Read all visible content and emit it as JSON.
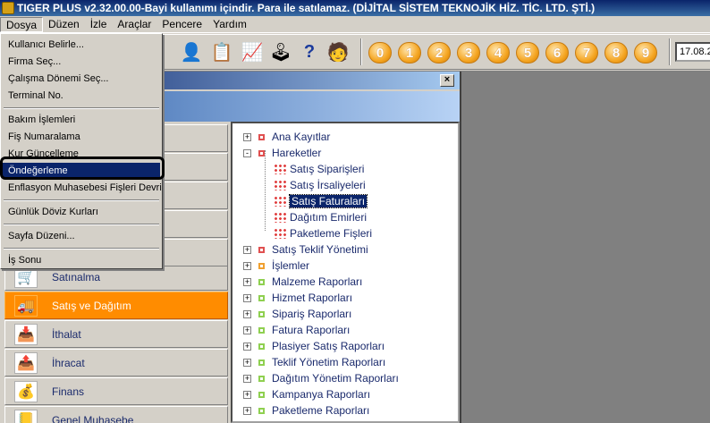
{
  "title": "TIGER PLUS v2.32.00.00-Bayi kullanımı içindir. Para ile satılamaz. (DİJİTAL SİSTEM TEKNOJİK HİZ. TİC. LTD. ŞTİ.)",
  "menubar": [
    "Dosya",
    "Düzen",
    "İzle",
    "Araçlar",
    "Pencere",
    "Yardım"
  ],
  "toolbar": {
    "icons": [
      "user-desk-icon",
      "document-star-icon",
      "chart-icon",
      "joystick-icon",
      "help-icon",
      "user-folder-icon"
    ],
    "number_buttons": [
      "0",
      "1",
      "2",
      "3",
      "4",
      "5",
      "6",
      "7",
      "8",
      "9"
    ],
    "date": "17.08.2"
  },
  "dosya_menu": {
    "items": [
      "Kullanıcı Belirle...",
      "Firma Seç...",
      "Çalışma Dönemi Seç...",
      "Terminal No.",
      "Bakım İşlemleri",
      "Fiş Numaralama",
      "Kur Güncelleme",
      "Öndeğerleme",
      "Enflasyon Muhasebesi Fişleri Devri",
      "Günlük Döviz Kurları",
      "Sayfa Düzeni...",
      "İş Sonu"
    ],
    "highlighted": "Öndeğerleme"
  },
  "window": {
    "close": "×"
  },
  "modules": [
    {
      "label": "Satınalma",
      "icon": "cart-icon",
      "glyph": "🛒"
    },
    {
      "label": "Satış ve Dağıtım",
      "icon": "truck-icon",
      "glyph": "🚚",
      "selected": true
    },
    {
      "label": "İthalat",
      "icon": "import-icon",
      "glyph": "📥"
    },
    {
      "label": "İhracat",
      "icon": "export-icon",
      "glyph": "📤"
    },
    {
      "label": "Finans",
      "icon": "coins-icon",
      "glyph": "💰"
    },
    {
      "label": "Genel Muhasebe",
      "icon": "ledger-icon",
      "glyph": "📒"
    }
  ],
  "tree": {
    "nodes": [
      {
        "label": "Ana Kayıtlar",
        "level": 0,
        "marker": "red",
        "expander": "+"
      },
      {
        "label": "Hareketler",
        "level": 0,
        "marker": "red",
        "expander": "-"
      },
      {
        "label": "Satış Siparişleri",
        "level": 1,
        "marker": "dots"
      },
      {
        "label": "Satış İrsaliyeleri",
        "level": 1,
        "marker": "dots"
      },
      {
        "label": "Satış Faturaları",
        "level": 1,
        "marker": "dots",
        "selected": true
      },
      {
        "label": "Dağıtım Emirleri",
        "level": 1,
        "marker": "dots"
      },
      {
        "label": "Paketleme Fişleri",
        "level": 1,
        "marker": "dots"
      },
      {
        "label": "Satış Teklif Yönetimi",
        "level": 0,
        "marker": "red",
        "expander": "+"
      },
      {
        "label": "İşlemler",
        "level": 0,
        "marker": "orange",
        "expander": "+"
      },
      {
        "label": "Malzeme Raporları",
        "level": 0,
        "marker": "green",
        "expander": "+"
      },
      {
        "label": "Hizmet Raporları",
        "level": 0,
        "marker": "green",
        "expander": "+"
      },
      {
        "label": "Sipariş Raporları",
        "level": 0,
        "marker": "green",
        "expander": "+"
      },
      {
        "label": "Fatura Raporları",
        "level": 0,
        "marker": "green",
        "expander": "+"
      },
      {
        "label": "Plasiyer Satış Raporları",
        "level": 0,
        "marker": "green",
        "expander": "+"
      },
      {
        "label": "Teklif Yönetim Raporları",
        "level": 0,
        "marker": "green",
        "expander": "+"
      },
      {
        "label": "Dağıtım Yönetim Raporları",
        "level": 0,
        "marker": "green",
        "expander": "+"
      },
      {
        "label": "Kampanya Raporları",
        "level": 0,
        "marker": "green",
        "expander": "+"
      },
      {
        "label": "Paketleme Raporları",
        "level": 0,
        "marker": "green",
        "expander": "+"
      }
    ]
  }
}
